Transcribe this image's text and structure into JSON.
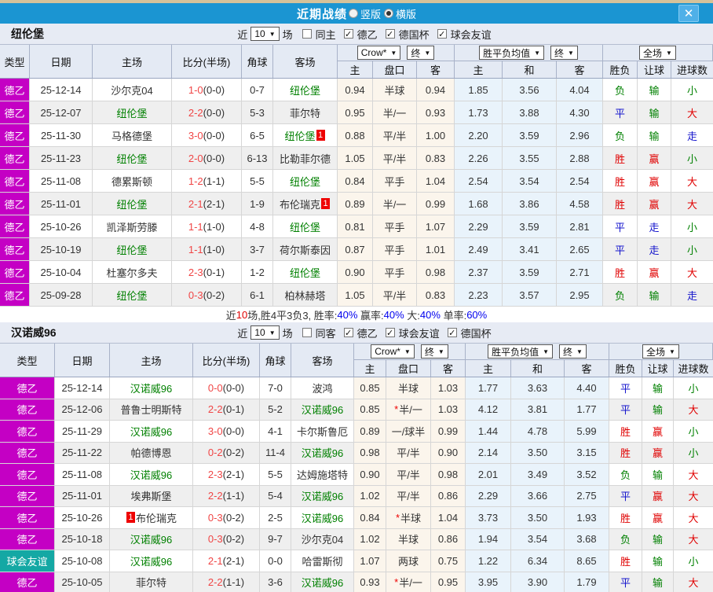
{
  "title_bar": {
    "title": "近期战绩",
    "radios": [
      {
        "label": "竖版",
        "checked": false
      },
      {
        "label": "横版",
        "checked": true
      }
    ],
    "close_label": "✕"
  },
  "palette": {
    "magenta": "#c400c4",
    "teal": "#14a8a4",
    "red": "#e00000",
    "green": "#008000",
    "blue": "#1414cc",
    "score_red": "#f04545",
    "pct_blue": "#0000ee",
    "text_black": "#333333"
  },
  "result_colors": {
    "胜": "red",
    "赢": "red",
    "大": "red",
    "平": "blue",
    "走": "blue",
    "负": "green",
    "输": "green",
    "小": "green"
  },
  "header_cols": {
    "static": [
      "类型",
      "日期",
      "主场",
      "比分(半场)",
      "角球",
      "客场"
    ],
    "odds_dd": "Crow*",
    "odds_final_dd": "终",
    "odds_sub": [
      "主",
      "盘口",
      "客"
    ],
    "avg_dd": "胜平负均值",
    "avg_final_dd": "终",
    "avg_sub": [
      "主",
      "和",
      "客"
    ],
    "full_dd": "全场",
    "result_sub": [
      "胜负",
      "让球",
      "进球数"
    ]
  },
  "sections": [
    {
      "team": "纽伦堡",
      "filter": {
        "near": "近",
        "count": "10",
        "games": "场",
        "same": {
          "label": "同主",
          "checked": false
        },
        "comps": [
          {
            "label": "德乙",
            "checked": true
          },
          {
            "label": "德国杯",
            "checked": true
          },
          {
            "label": "球会友谊",
            "checked": true
          }
        ]
      },
      "rows": [
        {
          "type": "德乙",
          "type_bg": "magenta",
          "date": "25-12-14",
          "home": "沙尔克04",
          "home_focus": false,
          "home_badge": "",
          "score": "1-0",
          "half": "(0-0)",
          "corner": "0-7",
          "away": "纽伦堡",
          "away_focus": true,
          "away_badge": "",
          "odds": [
            "0.94",
            "半球",
            "0.94"
          ],
          "star": false,
          "avg": [
            "1.85",
            "3.56",
            "4.04"
          ],
          "results": [
            "负",
            "输",
            "小"
          ]
        },
        {
          "type": "德乙",
          "type_bg": "magenta",
          "date": "25-12-07",
          "home": "纽伦堡",
          "home_focus": true,
          "home_badge": "",
          "score": "2-2",
          "half": "(0-0)",
          "corner": "5-3",
          "away": "菲尔特",
          "away_focus": false,
          "away_badge": "",
          "odds": [
            "0.95",
            "半/一",
            "0.93"
          ],
          "star": false,
          "avg": [
            "1.73",
            "3.88",
            "4.30"
          ],
          "results": [
            "平",
            "输",
            "大"
          ]
        },
        {
          "type": "德乙",
          "type_bg": "magenta",
          "date": "25-11-30",
          "home": "马格德堡",
          "home_focus": false,
          "home_badge": "",
          "score": "3-0",
          "half": "(0-0)",
          "corner": "6-5",
          "away": "纽伦堡",
          "away_focus": true,
          "away_badge": "1",
          "away_badge_pos": "after",
          "odds": [
            "0.88",
            "平/半",
            "1.00"
          ],
          "star": false,
          "avg": [
            "2.20",
            "3.59",
            "2.96"
          ],
          "results": [
            "负",
            "输",
            "走"
          ]
        },
        {
          "type": "德乙",
          "type_bg": "magenta",
          "date": "25-11-23",
          "home": "纽伦堡",
          "home_focus": true,
          "home_badge": "",
          "score": "2-0",
          "half": "(0-0)",
          "corner": "6-13",
          "away": "比勒菲尔德",
          "away_focus": false,
          "away_badge": "",
          "odds": [
            "1.05",
            "平/半",
            "0.83"
          ],
          "star": false,
          "avg": [
            "2.26",
            "3.55",
            "2.88"
          ],
          "results": [
            "胜",
            "赢",
            "小"
          ]
        },
        {
          "type": "德乙",
          "type_bg": "magenta",
          "date": "25-11-08",
          "home": "德累斯顿",
          "home_focus": false,
          "home_badge": "",
          "score": "1-2",
          "half": "(1-1)",
          "corner": "5-5",
          "away": "纽伦堡",
          "away_focus": true,
          "away_badge": "",
          "odds": [
            "0.84",
            "平手",
            "1.04"
          ],
          "star": false,
          "avg": [
            "2.54",
            "3.54",
            "2.54"
          ],
          "results": [
            "胜",
            "赢",
            "大"
          ]
        },
        {
          "type": "德乙",
          "type_bg": "magenta",
          "date": "25-11-01",
          "home": "纽伦堡",
          "home_focus": true,
          "home_badge": "",
          "score": "2-1",
          "half": "(2-1)",
          "corner": "1-9",
          "away": "布伦瑞克",
          "away_focus": false,
          "away_badge": "1",
          "away_badge_pos": "after",
          "odds": [
            "0.89",
            "半/一",
            "0.99"
          ],
          "star": false,
          "avg": [
            "1.68",
            "3.86",
            "4.58"
          ],
          "results": [
            "胜",
            "赢",
            "大"
          ]
        },
        {
          "type": "德乙",
          "type_bg": "magenta",
          "date": "25-10-26",
          "home": "凯泽斯劳滕",
          "home_focus": false,
          "home_badge": "",
          "score": "1-1",
          "half": "(1-0)",
          "corner": "4-8",
          "away": "纽伦堡",
          "away_focus": true,
          "away_badge": "",
          "odds": [
            "0.81",
            "平手",
            "1.07"
          ],
          "star": false,
          "avg": [
            "2.29",
            "3.59",
            "2.81"
          ],
          "results": [
            "平",
            "走",
            "小"
          ]
        },
        {
          "type": "德乙",
          "type_bg": "magenta",
          "date": "25-10-19",
          "home": "纽伦堡",
          "home_focus": true,
          "home_badge": "",
          "score": "1-1",
          "half": "(1-0)",
          "corner": "3-7",
          "away": "荷尔斯泰因",
          "away_focus": false,
          "away_badge": "",
          "odds": [
            "0.87",
            "平手",
            "1.01"
          ],
          "star": false,
          "avg": [
            "2.49",
            "3.41",
            "2.65"
          ],
          "results": [
            "平",
            "走",
            "小"
          ]
        },
        {
          "type": "德乙",
          "type_bg": "magenta",
          "date": "25-10-04",
          "home": "杜塞尔多夫",
          "home_focus": false,
          "home_badge": "",
          "score": "2-3",
          "half": "(0-1)",
          "corner": "1-2",
          "away": "纽伦堡",
          "away_focus": true,
          "away_badge": "",
          "odds": [
            "0.90",
            "平手",
            "0.98"
          ],
          "star": false,
          "avg": [
            "2.37",
            "3.59",
            "2.71"
          ],
          "results": [
            "胜",
            "赢",
            "大"
          ]
        },
        {
          "type": "德乙",
          "type_bg": "magenta",
          "date": "25-09-28",
          "home": "纽伦堡",
          "home_focus": true,
          "home_badge": "",
          "score": "0-3",
          "half": "(0-2)",
          "corner": "6-1",
          "away": "柏林赫塔",
          "away_focus": false,
          "away_badge": "",
          "odds": [
            "1.05",
            "平/半",
            "0.83"
          ],
          "star": false,
          "avg": [
            "2.23",
            "3.57",
            "2.95"
          ],
          "results": [
            "负",
            "输",
            "走"
          ]
        }
      ],
      "summary": [
        [
          "近",
          "k"
        ],
        [
          "10",
          "r"
        ],
        [
          "场,胜4平3负3, 胜率:",
          "k"
        ],
        [
          "40%",
          "b"
        ],
        [
          " 赢率:",
          "k"
        ],
        [
          "40%",
          "b"
        ],
        [
          " 大:",
          "k"
        ],
        [
          "40%",
          "b"
        ],
        [
          " 单率:",
          "k"
        ],
        [
          "60%",
          "b"
        ]
      ]
    },
    {
      "team": "汉诺威96",
      "filter": {
        "near": "近",
        "count": "10",
        "games": "场",
        "same": {
          "label": "同客",
          "checked": false
        },
        "comps": [
          {
            "label": "德乙",
            "checked": true
          },
          {
            "label": "球会友谊",
            "checked": true
          },
          {
            "label": "德国杯",
            "checked": true
          }
        ]
      },
      "rows": [
        {
          "type": "德乙",
          "type_bg": "magenta",
          "date": "25-12-14",
          "home": "汉诺威96",
          "home_focus": true,
          "home_badge": "",
          "score": "0-0",
          "half": "(0-0)",
          "corner": "7-0",
          "away": "波鸿",
          "away_focus": false,
          "away_badge": "",
          "odds": [
            "0.85",
            "半球",
            "1.03"
          ],
          "star": false,
          "avg": [
            "1.77",
            "3.63",
            "4.40"
          ],
          "results": [
            "平",
            "输",
            "小"
          ]
        },
        {
          "type": "德乙",
          "type_bg": "magenta",
          "date": "25-12-06",
          "home": "普鲁士明斯特",
          "home_focus": false,
          "home_badge": "",
          "score": "2-2",
          "half": "(0-1)",
          "corner": "5-2",
          "away": "汉诺威96",
          "away_focus": true,
          "away_badge": "",
          "odds": [
            "0.85",
            "半/一",
            "1.03"
          ],
          "star": true,
          "avg": [
            "4.12",
            "3.81",
            "1.77"
          ],
          "results": [
            "平",
            "输",
            "大"
          ]
        },
        {
          "type": "德乙",
          "type_bg": "magenta",
          "date": "25-11-29",
          "home": "汉诺威96",
          "home_focus": true,
          "home_badge": "",
          "score": "3-0",
          "half": "(0-0)",
          "corner": "4-1",
          "away": "卡尔斯鲁厄",
          "away_focus": false,
          "away_badge": "",
          "odds": [
            "0.89",
            "一/球半",
            "0.99"
          ],
          "star": false,
          "avg": [
            "1.44",
            "4.78",
            "5.99"
          ],
          "results": [
            "胜",
            "赢",
            "小"
          ]
        },
        {
          "type": "德乙",
          "type_bg": "magenta",
          "date": "25-11-22",
          "home": "帕德博恩",
          "home_focus": false,
          "home_badge": "",
          "score": "0-2",
          "half": "(0-2)",
          "corner": "11-4",
          "away": "汉诺威96",
          "away_focus": true,
          "away_badge": "",
          "odds": [
            "0.98",
            "平/半",
            "0.90"
          ],
          "star": false,
          "avg": [
            "2.14",
            "3.50",
            "3.15"
          ],
          "results": [
            "胜",
            "赢",
            "小"
          ]
        },
        {
          "type": "德乙",
          "type_bg": "magenta",
          "date": "25-11-08",
          "home": "汉诺威96",
          "home_focus": true,
          "home_badge": "",
          "score": "2-3",
          "half": "(2-1)",
          "corner": "5-5",
          "away": "达姆施塔特",
          "away_focus": false,
          "away_badge": "",
          "odds": [
            "0.90",
            "平/半",
            "0.98"
          ],
          "star": false,
          "avg": [
            "2.01",
            "3.49",
            "3.52"
          ],
          "results": [
            "负",
            "输",
            "大"
          ]
        },
        {
          "type": "德乙",
          "type_bg": "magenta",
          "date": "25-11-01",
          "home": "埃弗斯堡",
          "home_focus": false,
          "home_badge": "",
          "score": "2-2",
          "half": "(1-1)",
          "corner": "5-4",
          "away": "汉诺威96",
          "away_focus": true,
          "away_badge": "",
          "odds": [
            "1.02",
            "平/半",
            "0.86"
          ],
          "star": false,
          "avg": [
            "2.29",
            "3.66",
            "2.75"
          ],
          "results": [
            "平",
            "赢",
            "大"
          ]
        },
        {
          "type": "德乙",
          "type_bg": "magenta",
          "date": "25-10-26",
          "home": "布伦瑞克",
          "home_focus": false,
          "home_badge": "1",
          "home_badge_pos": "before",
          "score": "0-3",
          "half": "(0-2)",
          "corner": "2-5",
          "away": "汉诺威96",
          "away_focus": true,
          "away_badge": "",
          "odds": [
            "0.84",
            "半球",
            "1.04"
          ],
          "star": true,
          "avg": [
            "3.73",
            "3.50",
            "1.93"
          ],
          "results": [
            "胜",
            "赢",
            "大"
          ]
        },
        {
          "type": "德乙",
          "type_bg": "magenta",
          "date": "25-10-18",
          "home": "汉诺威96",
          "home_focus": true,
          "home_badge": "",
          "score": "0-3",
          "half": "(0-2)",
          "corner": "9-7",
          "away": "沙尔克04",
          "away_focus": false,
          "away_badge": "",
          "odds": [
            "1.02",
            "半球",
            "0.86"
          ],
          "star": false,
          "avg": [
            "1.94",
            "3.54",
            "3.68"
          ],
          "results": [
            "负",
            "输",
            "大"
          ]
        },
        {
          "type": "球会友谊",
          "type_bg": "teal",
          "date": "25-10-08",
          "home": "汉诺威96",
          "home_focus": true,
          "home_badge": "",
          "score": "2-1",
          "half": "(2-1)",
          "corner": "0-0",
          "away": "哈雷斯彻",
          "away_focus": false,
          "away_badge": "",
          "odds": [
            "1.07",
            "两球",
            "0.75"
          ],
          "star": false,
          "avg": [
            "1.22",
            "6.34",
            "8.65"
          ],
          "results": [
            "胜",
            "输",
            "小"
          ]
        },
        {
          "type": "德乙",
          "type_bg": "magenta",
          "date": "25-10-05",
          "home": "菲尔特",
          "home_focus": false,
          "home_badge": "",
          "score": "2-2",
          "half": "(1-1)",
          "corner": "3-6",
          "away": "汉诺威96",
          "away_focus": true,
          "away_badge": "",
          "odds": [
            "0.93",
            "半/一",
            "0.95"
          ],
          "star": true,
          "avg": [
            "3.95",
            "3.90",
            "1.79"
          ],
          "results": [
            "平",
            "输",
            "大"
          ]
        }
      ],
      "summary": null
    }
  ]
}
